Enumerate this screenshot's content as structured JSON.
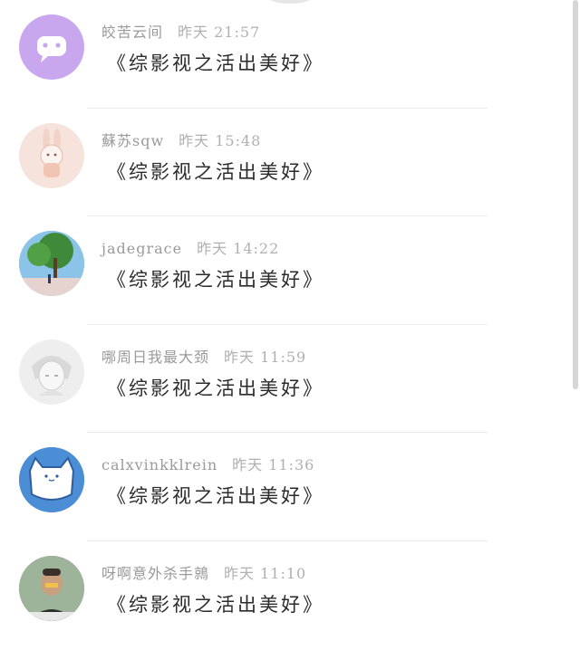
{
  "comments": [
    {
      "username": "皎苦云间",
      "time": "昨天 21:57",
      "text": "《综影视之活出美好》",
      "avatar_icon": "chat-bubble-icon",
      "avatar_color": "#c8a7ee"
    },
    {
      "username": "蘇苏sqw",
      "time": "昨天 15:48",
      "text": "《综影视之活出美好》",
      "avatar_icon": "bunny-illustration",
      "avatar_color": "#f6e4dc"
    },
    {
      "username": "jadegrace",
      "time": "昨天 14:22",
      "text": "《综影视之活出美好》",
      "avatar_icon": "tree-landscape",
      "avatar_color": "#7fb6df"
    },
    {
      "username": "哪周日我最大颈",
      "time": "昨天 11:59",
      "text": "《综影视之活出美好》",
      "avatar_icon": "anime-boy-sketch",
      "avatar_color": "#eeeeee"
    },
    {
      "username": "calxvinkklrein",
      "time": "昨天 11:36",
      "text": "《综影视之活出美好》",
      "avatar_icon": "cat-mug",
      "avatar_color": "#3f7ecf"
    },
    {
      "username": "呀啊意外杀手鶁",
      "time": "昨天 11:10",
      "text": "《综影视之活出美好》",
      "avatar_icon": "person-photo",
      "avatar_color": "#6f8a6a"
    }
  ]
}
